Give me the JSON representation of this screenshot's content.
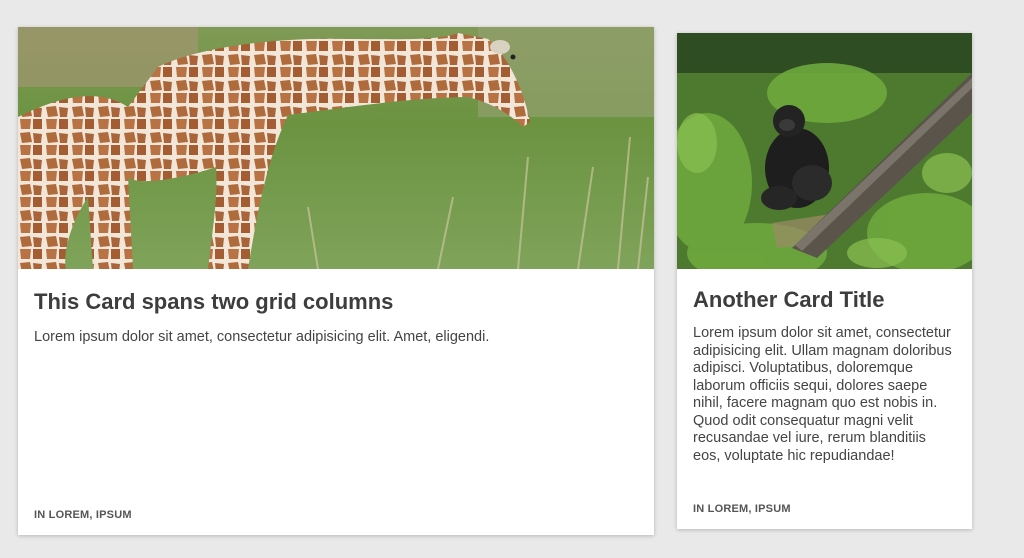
{
  "cards": [
    {
      "title": "This Card spans two grid columns",
      "text": "Lorem ipsum dolor sit amet, consectetur adipisicing elit. Amet, eligendi.",
      "footer": "IN LOREM, IPSUM",
      "image": "giraffe-photo"
    },
    {
      "title": "Another Card Title",
      "text": "Lorem ipsum dolor sit amet, consectetur adipisicing elit. Ullam magnam doloribus adipisci. Voluptatibus, doloremque laborum officiis sequi, dolores saepe nihil, facere magnam quo est nobis in. Quod odit consequatur magni velit recusandae vel iure, rerum blanditiis eos, voluptate hic repudiandae!",
      "footer": "IN LOREM, IPSUM",
      "image": "gorilla-photo"
    }
  ],
  "colors": {
    "page_background": "#e9e9e9",
    "card_background": "#ffffff",
    "title": "#3d3d3d",
    "text": "#444444",
    "footer": "#555555"
  }
}
